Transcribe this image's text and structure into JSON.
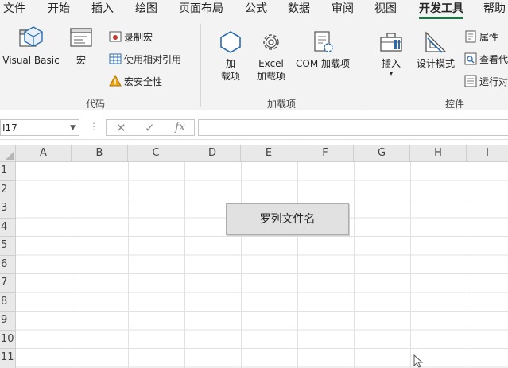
{
  "menu": {
    "tabs": [
      "文件",
      "开始",
      "插入",
      "绘图",
      "页面布局",
      "公式",
      "数据",
      "审阅",
      "视图",
      "开发工具",
      "帮助"
    ]
  },
  "ribbon": {
    "code_group": {
      "label": "代码",
      "visual_basic": "Visual Basic",
      "macros": "宏",
      "record_macro": "录制宏",
      "relative_ref": "使用相对引用",
      "macro_security": "宏安全性"
    },
    "addins_group": {
      "label": "加载项",
      "addins_line1": "加",
      "addins_line2": "载项",
      "excel_line1": "Excel",
      "excel_line2": "加载项",
      "com_addins": "COM 加载项"
    },
    "controls_group": {
      "label": "控件",
      "insert": "插入",
      "insert_arrow": "▾",
      "design_mode": "设计模式",
      "properties": "属性",
      "view_code": "查看代",
      "run_dialog": "运行对"
    }
  },
  "formula_bar": {
    "name_box": "I17",
    "fx": "fx",
    "cancel": "✕",
    "enter": "✓",
    "formula": ""
  },
  "sheet": {
    "columns": [
      "A",
      "B",
      "C",
      "D",
      "E",
      "F",
      "G",
      "H",
      "I"
    ],
    "rows": [
      "1",
      "2",
      "3",
      "4",
      "5",
      "6",
      "7",
      "8",
      "9",
      "10",
      "11"
    ],
    "button_label": "罗列文件名"
  },
  "colors": {
    "accent": "#217346",
    "ribbon_bg": "#f3f3f3",
    "icon_blue": "#2b6cb0",
    "warning": "#e8a317"
  }
}
